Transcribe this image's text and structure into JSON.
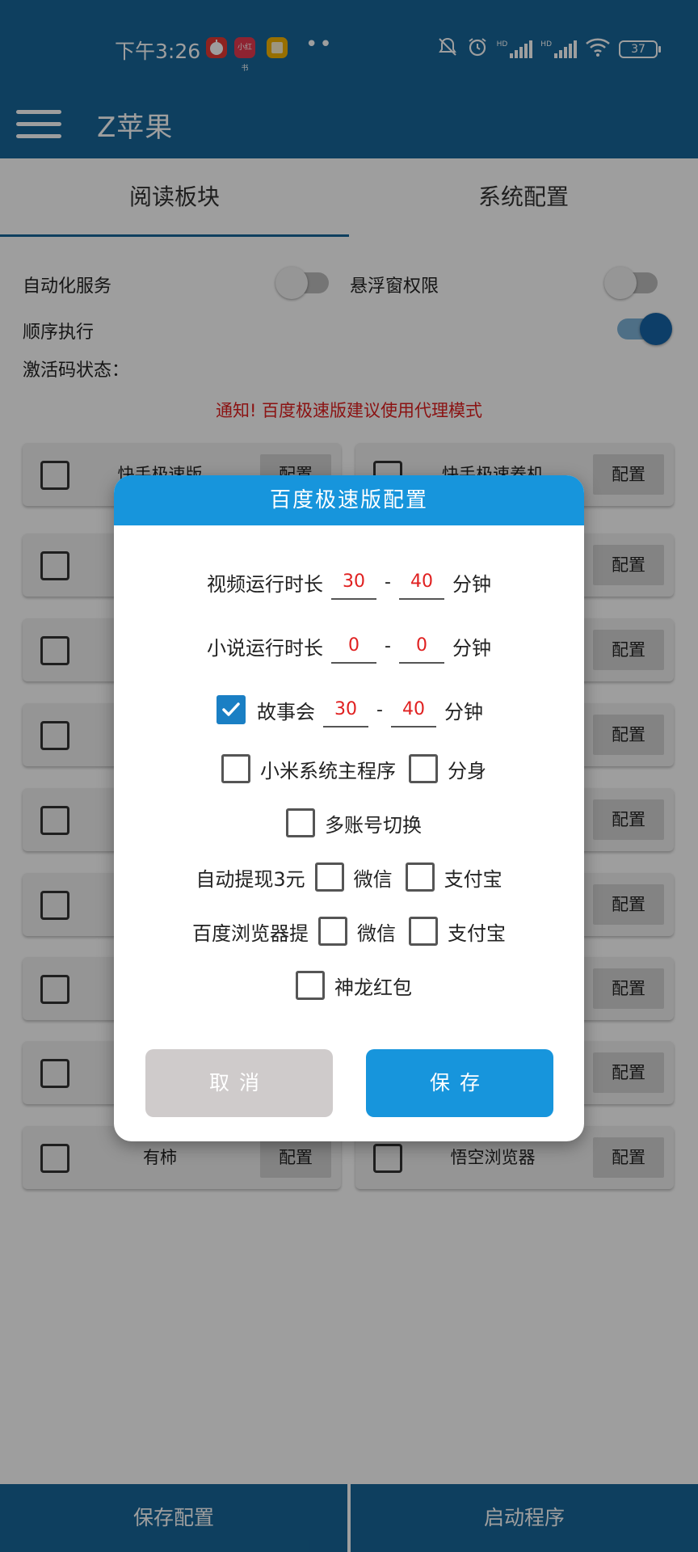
{
  "status_bar": {
    "time": "下午3:26",
    "app_icons": [
      {
        "icon": "apple-app-icon",
        "label": "🍎",
        "color": "#e53935"
      },
      {
        "icon": "xiaohongshu-app-icon",
        "label": "小红书",
        "color": "#e53950"
      },
      {
        "icon": "notes-app-icon",
        "label": "",
        "color": "#f4b400"
      }
    ],
    "more_dots": "••",
    "hd1": "HD",
    "hd2": "HD",
    "battery": "37"
  },
  "app_bar": {
    "title": "Z苹果"
  },
  "tabs": [
    "阅读板块",
    "系统配置"
  ],
  "settings": {
    "auto_service": "自动化服务",
    "floating_permission": "悬浮窗权限",
    "sequential": "顺序执行",
    "activation_status": "激活码状态：",
    "auto_service_on": false,
    "floating_on": false,
    "sequential_on": true
  },
  "notice": "通知! 百度极速版建议使用代理模式",
  "cards": {
    "config_label": "配置",
    "visible": [
      {
        "name": "快手极速版",
        "side": "left"
      },
      {
        "name": "快手极速养机",
        "side": "right"
      },
      {
        "name": "有柿",
        "side": "left"
      },
      {
        "name": "悟空浏览器",
        "side": "right"
      }
    ]
  },
  "bottom_bar": {
    "save_config": "保存配置",
    "start_program": "启动程序"
  },
  "dialog": {
    "title": "百度极速版配置",
    "video_label": "视频运行时长",
    "video_min": "30",
    "video_max": "40",
    "novel_label": "小说运行时长",
    "novel_min": "0",
    "novel_max": "0",
    "story_label": "故事会",
    "story_checked": true,
    "story_min": "30",
    "story_max": "40",
    "unit": "分钟",
    "dash": "-",
    "xiaomi_main": "小米系统主程序",
    "clone": "分身",
    "multi_account": "多账号切换",
    "auto_withdraw": "自动提现3元",
    "wechat": "微信",
    "alipay": "支付宝",
    "baidu_browser": "百度浏览器提",
    "shenlong": "神龙红包",
    "cancel": "取消",
    "save": "保存",
    "colors": {
      "header": "#1795dc",
      "save": "#1795dc",
      "cancel": "#cfcbcb",
      "number": "#e02020"
    }
  }
}
